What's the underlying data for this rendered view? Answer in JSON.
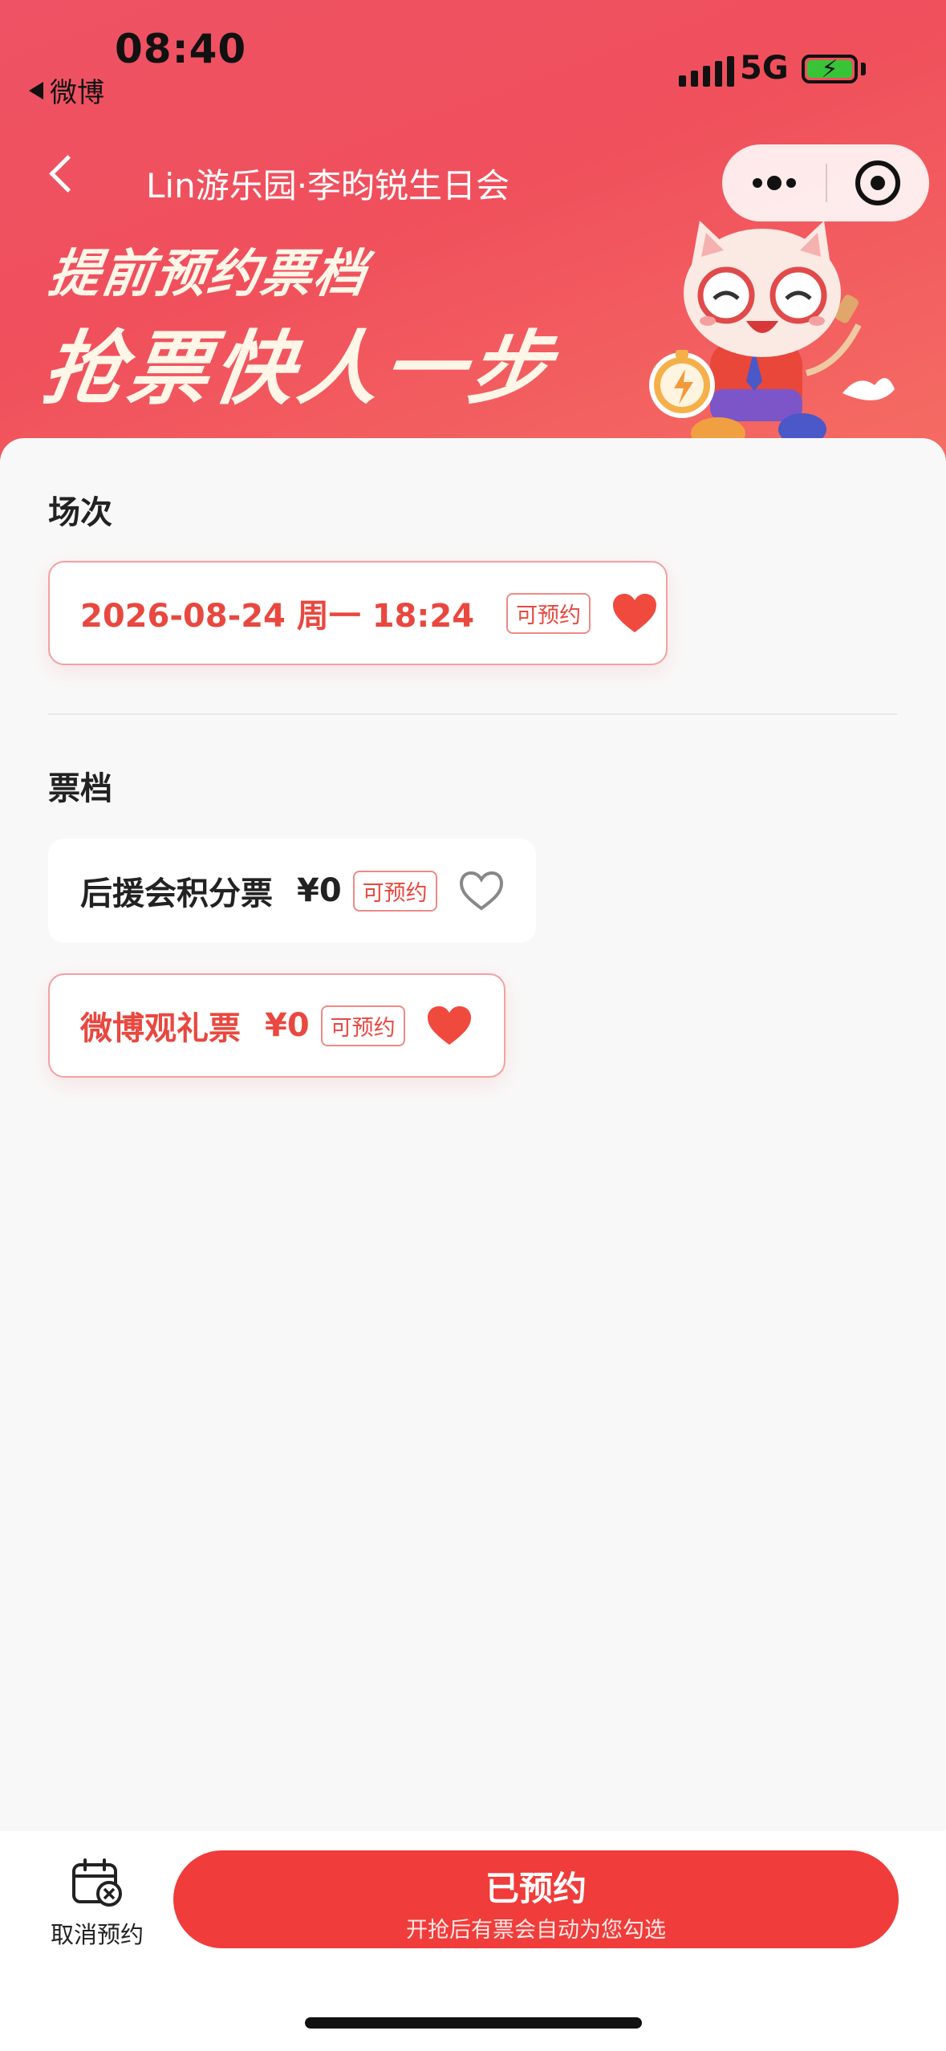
{
  "status_bar": {
    "time": "08:40",
    "back_app": "微博",
    "network": "5G"
  },
  "nav": {
    "title": "Lin游乐园·李昀锐生日会"
  },
  "banner": {
    "line1": "提前预约票档",
    "line2": "抢票快人一步"
  },
  "sessions": {
    "title": "场次",
    "items": [
      {
        "label": "2026-08-24 周一 18:24",
        "tag": "可预约",
        "selected": true
      }
    ]
  },
  "tickets": {
    "title": "票档",
    "items": [
      {
        "label": "后援会积分票",
        "price": "¥0",
        "tag": "可预约",
        "selected": false
      },
      {
        "label": "微博观礼票",
        "price": "¥0",
        "tag": "可预约",
        "selected": true
      }
    ]
  },
  "bottom": {
    "cancel_label": "取消预约",
    "button_main": "已预约",
    "button_sub": "开抢后有票会自动为您勾选"
  },
  "colors": {
    "accent": "#f03c3a",
    "header": "#f0505c",
    "selected_text": "#e8483f"
  }
}
